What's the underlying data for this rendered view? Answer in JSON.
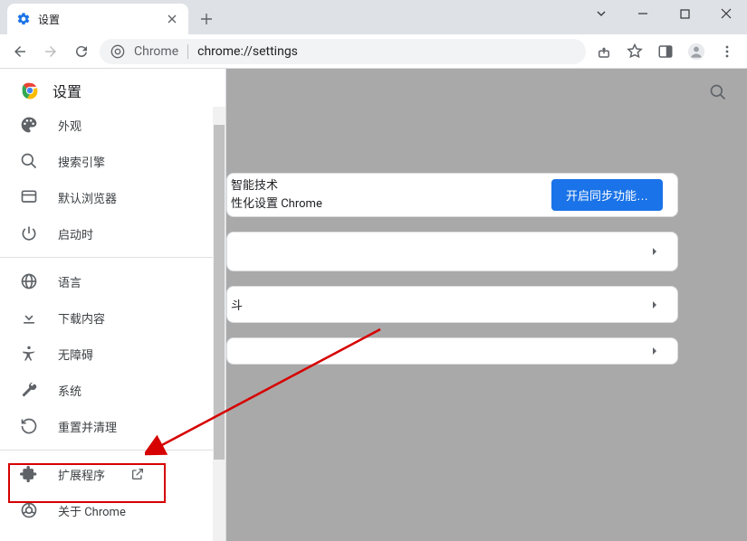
{
  "window": {
    "tab_title": "设置",
    "omnibox_prefix": "Chrome",
    "omnibox_url": "chrome://settings"
  },
  "sidebar": {
    "title": "设置",
    "items": [
      {
        "icon": "palette",
        "label": "外观"
      },
      {
        "icon": "search",
        "label": "搜索引擎"
      },
      {
        "icon": "browser",
        "label": "默认浏览器"
      },
      {
        "icon": "power",
        "label": "启动时"
      }
    ],
    "items2": [
      {
        "icon": "globe",
        "label": "语言"
      },
      {
        "icon": "download",
        "label": "下载内容"
      },
      {
        "icon": "accessibility",
        "label": "无障碍"
      },
      {
        "icon": "wrench",
        "label": "系统"
      },
      {
        "icon": "restore",
        "label": "重置并清理"
      }
    ],
    "items3": [
      {
        "icon": "extension",
        "label": "扩展程序",
        "external": true
      },
      {
        "icon": "chrome",
        "label": "关于 Chrome"
      }
    ]
  },
  "main": {
    "card1_line1": "智能技术",
    "card1_line2": "性化设置 Chrome",
    "sync_button": "开启同步功能…",
    "card3_text": "斗"
  }
}
